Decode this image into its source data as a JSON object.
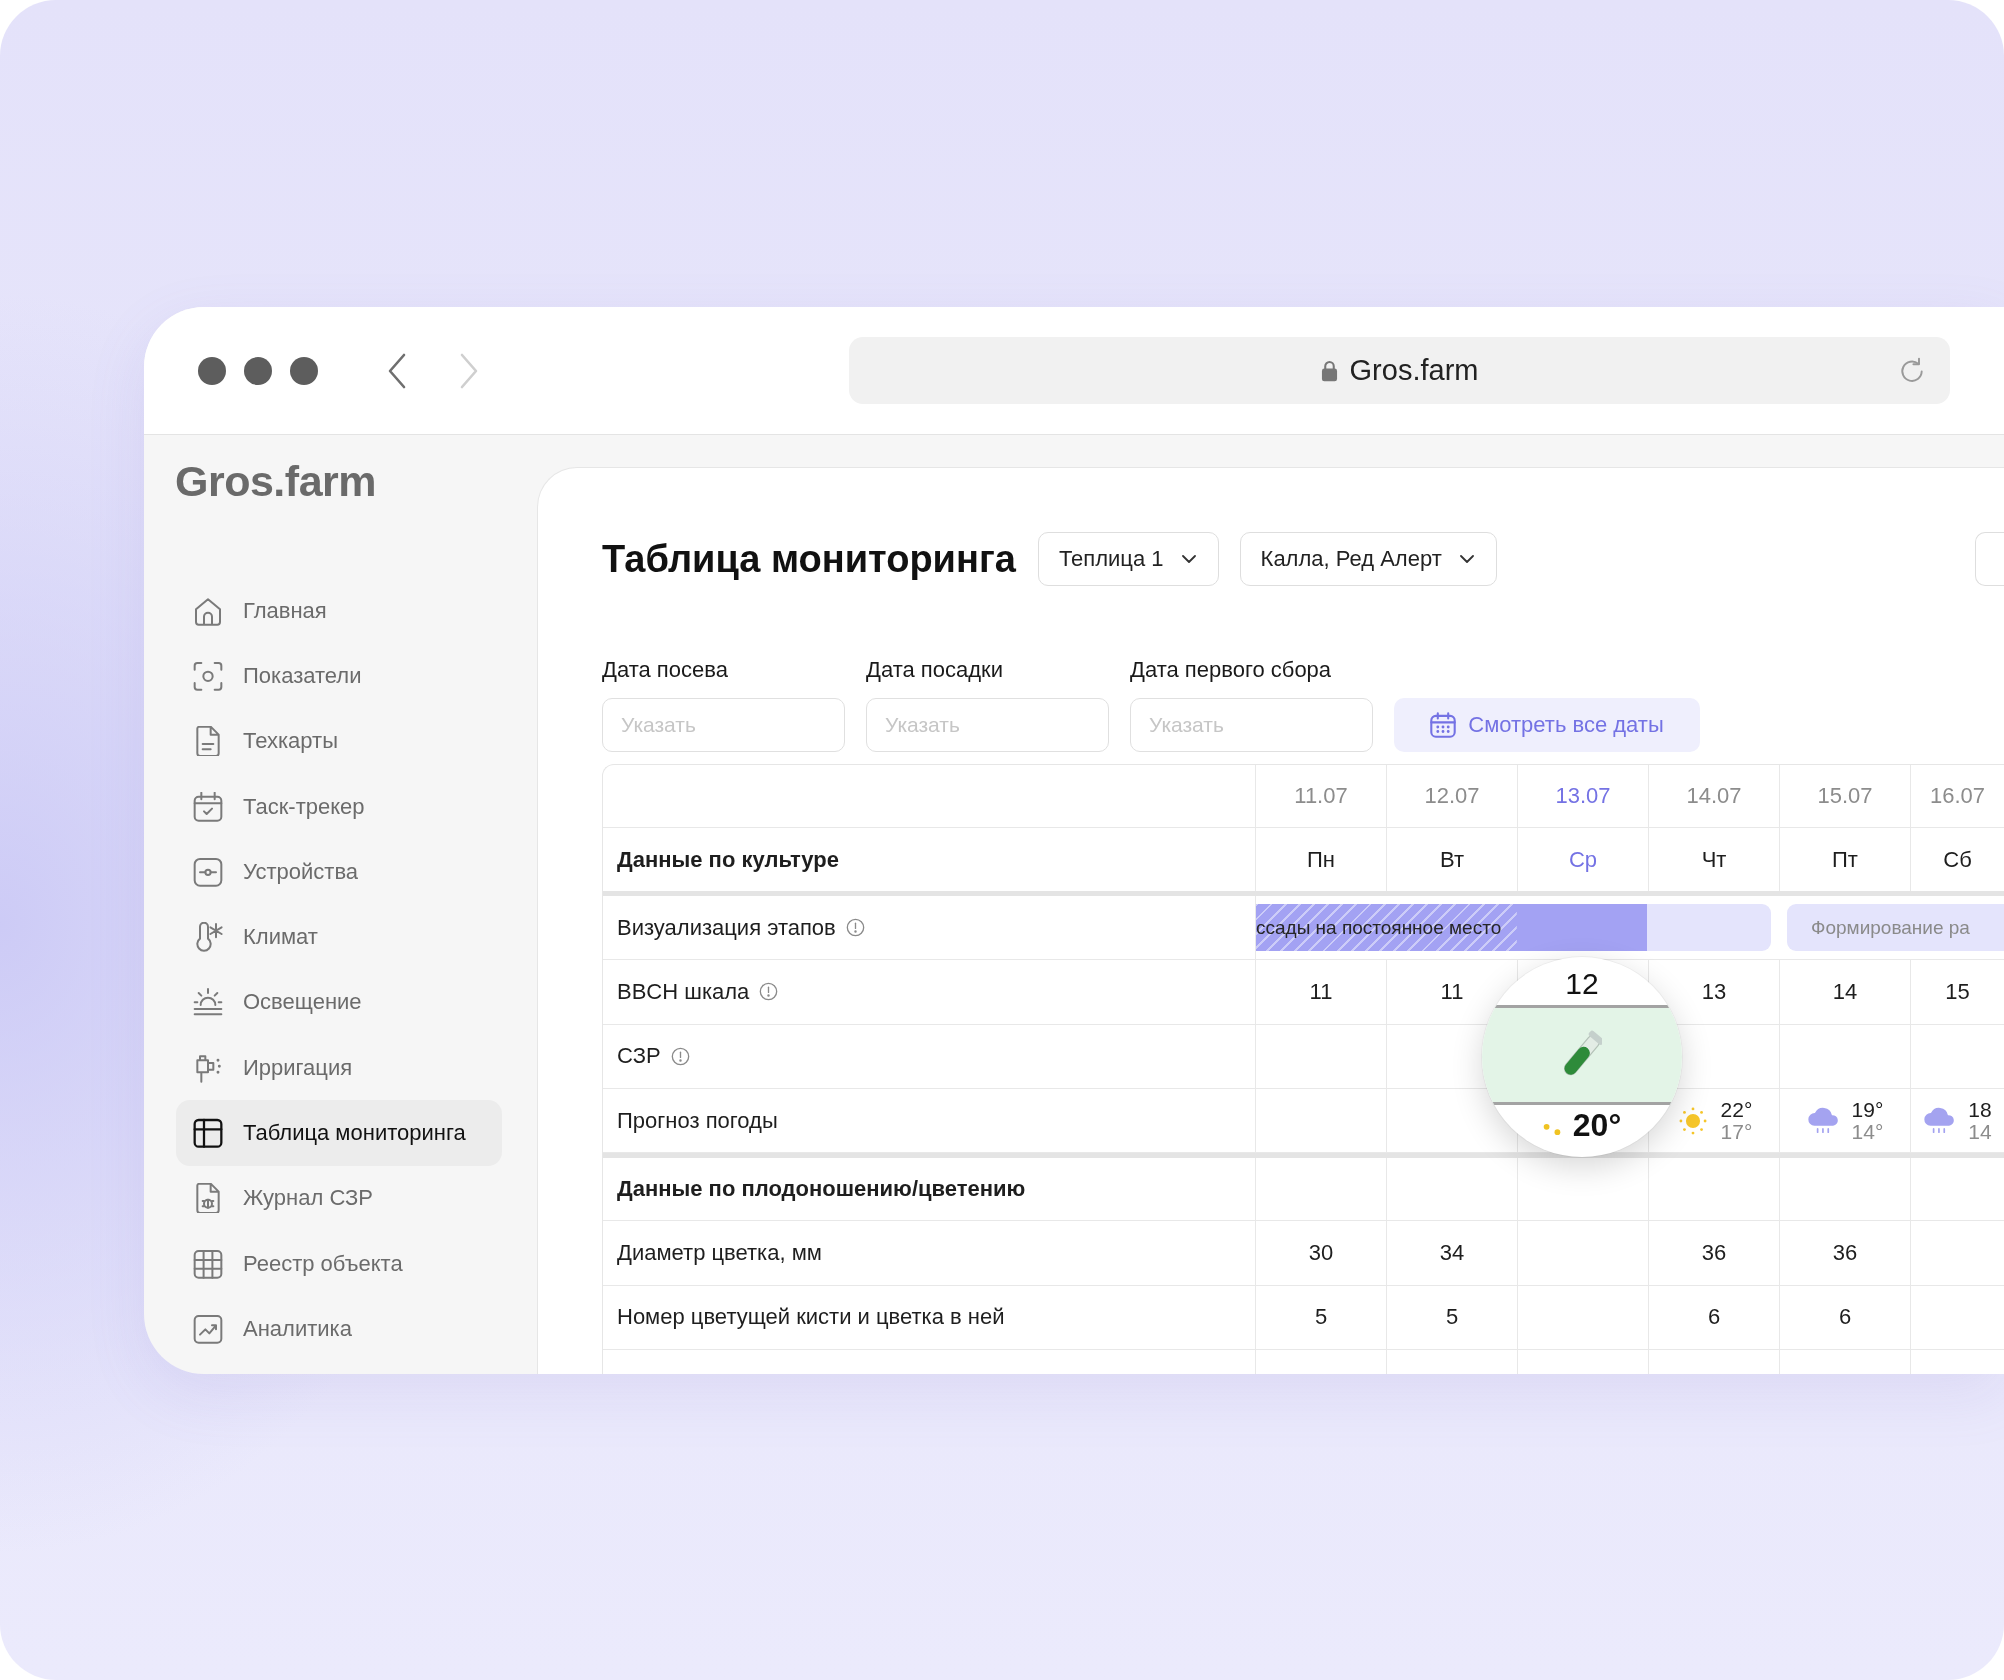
{
  "browser": {
    "url": "Gros.farm",
    "back_disabled": false,
    "forward_disabled": true
  },
  "sidebar": {
    "logo": "Gros.farm",
    "items": [
      {
        "label": "Главная",
        "selected": false
      },
      {
        "label": "Показатели",
        "selected": false
      },
      {
        "label": "Техкарты",
        "selected": false
      },
      {
        "label": "Таск-трекер",
        "selected": false
      },
      {
        "label": "Устройства",
        "selected": false
      },
      {
        "label": "Климат",
        "selected": false
      },
      {
        "label": "Освещение",
        "selected": false
      },
      {
        "label": "Ирригация",
        "selected": false
      },
      {
        "label": "Таблица мониторинга",
        "selected": true
      },
      {
        "label": "Журнал СЗР",
        "selected": false
      },
      {
        "label": "Реестр объекта",
        "selected": false
      },
      {
        "label": "Аналитика",
        "selected": false
      }
    ]
  },
  "page": {
    "title": "Таблица мониторинга",
    "filters": [
      {
        "kind": "dropdown",
        "label": "Теплица 1"
      },
      {
        "kind": "dropdown",
        "label": "Калла, Ред Алерт"
      },
      {
        "kind": "partial"
      }
    ],
    "date_fields": [
      {
        "label": "Дата посева",
        "placeholder": "Указать"
      },
      {
        "label": "Дата посадки",
        "placeholder": "Указать"
      },
      {
        "label": "Дата первого сбора",
        "placeholder": "Указать"
      }
    ],
    "all_dates_button": "Смотреть все даты"
  },
  "table": {
    "columns": [
      {
        "date": "11.07",
        "weekday": "Пн",
        "selected": false
      },
      {
        "date": "12.07",
        "weekday": "Вт",
        "selected": false
      },
      {
        "date": "13.07",
        "weekday": "Ср",
        "selected": true
      },
      {
        "date": "14.07",
        "weekday": "Чт",
        "selected": false
      },
      {
        "date": "15.07",
        "weekday": "Пт",
        "selected": false
      },
      {
        "date": "16.07",
        "weekday": "Сб",
        "selected": false
      }
    ],
    "group_label": "Данные по культуре",
    "rows": [
      {
        "kind": "stages",
        "label": "Визуализация этапов",
        "info": true,
        "stages": [
          {
            "label": "ссады на постоянное место",
            "level": 0.76
          },
          {
            "label": "Формирование ра"
          }
        ]
      },
      {
        "kind": "values",
        "label": "BBCH шкала",
        "info": true,
        "cells": [
          "11",
          "11",
          null,
          "13",
          "14",
          "15"
        ]
      },
      {
        "kind": "values",
        "label": "СЗР",
        "info": true
      },
      {
        "kind": "weather",
        "label": "Прогноз погоды",
        "info": false,
        "cells": [
          null,
          null,
          null,
          {
            "kind": "sun",
            "high": "22°",
            "low": "17°"
          },
          {
            "kind": "rain",
            "high": "19°",
            "low": "14°"
          },
          {
            "kind": "rain",
            "high": "18",
            "low": "14"
          }
        ]
      },
      {
        "kind": "section",
        "label": "Данные по плодоношению/цветению",
        "info": false
      },
      {
        "kind": "values",
        "label": "Диаметр цветка, мм",
        "info": false,
        "cells": [
          "30",
          "34",
          null,
          "36",
          "36",
          null
        ]
      },
      {
        "kind": "values",
        "label": "Номер цветущей кисти и цветка в ней",
        "info": false,
        "cells": [
          "5",
          "5",
          null,
          "6",
          "6",
          null
        ]
      },
      {
        "kind": "blank",
        "info": false
      }
    ]
  },
  "magnifier": {
    "bbch": "12",
    "treatment": true,
    "temperature": "20°"
  }
}
